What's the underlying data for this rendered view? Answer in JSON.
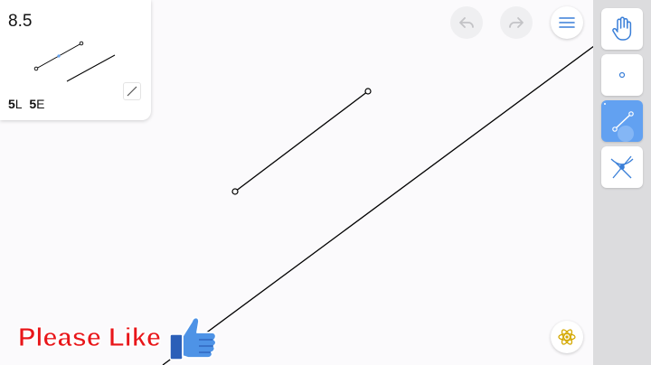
{
  "level": {
    "title": "8.5"
  },
  "score": {
    "l_count": "5",
    "l_unit": "L",
    "e_count": "5",
    "e_unit": "E"
  },
  "banner": {
    "text": "Please Like"
  },
  "colors": {
    "accent": "#62a1f1",
    "icon_blue": "#3a7fd8",
    "stroke": "#000000",
    "banner_red": "#e8161a"
  },
  "toolbar": {
    "tools": [
      {
        "name": "hand",
        "icon": "hand-icon"
      },
      {
        "name": "point",
        "icon": "point-icon"
      },
      {
        "name": "line",
        "icon": "line-icon",
        "active": true
      },
      {
        "name": "intersection",
        "icon": "intersection-icon"
      }
    ]
  },
  "icons": {
    "undo": "undo-icon",
    "redo": "redo-icon",
    "menu": "hamburger-menu-icon",
    "settings": "atom-icon",
    "thumb": "thumbs-up-icon"
  }
}
